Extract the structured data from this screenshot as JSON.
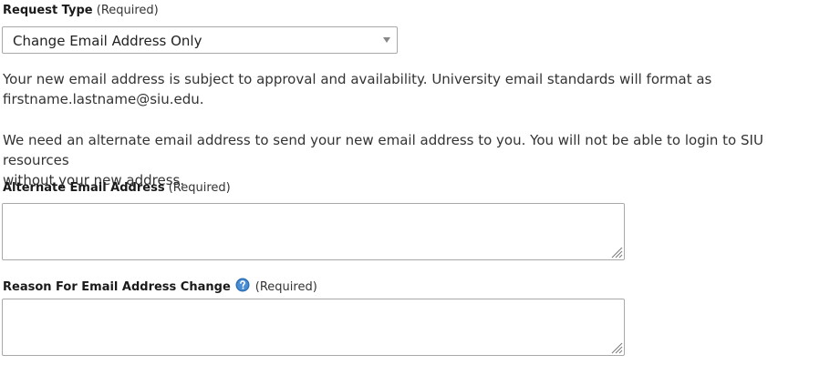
{
  "request_type": {
    "label": "Request Type",
    "required": "(Required)",
    "selected_value": "Change Email Address Only"
  },
  "intro": {
    "paragraph_1_line_1": "Your new email address is subject to approval and availability. University email standards will format as",
    "paragraph_1_line_2": "firstname.lastname@siu.edu.",
    "paragraph_2_line_1": "We need an alternate email address to send your new email address to you. You will not be able to login to SIU resources",
    "paragraph_2_line_2": "without your new address."
  },
  "alternate_email": {
    "label": "Alternate Email Address",
    "required": "(Required)",
    "value": ""
  },
  "reason": {
    "label": "Reason For Email Address Change",
    "required": "(Required)",
    "value": ""
  },
  "colors": {
    "help_icon": "#2f6fb5",
    "border": "#a9a9a9"
  },
  "icons": {
    "help": "question-mark-circle",
    "dropdown": "caret-down",
    "resize": "resize-grip"
  }
}
